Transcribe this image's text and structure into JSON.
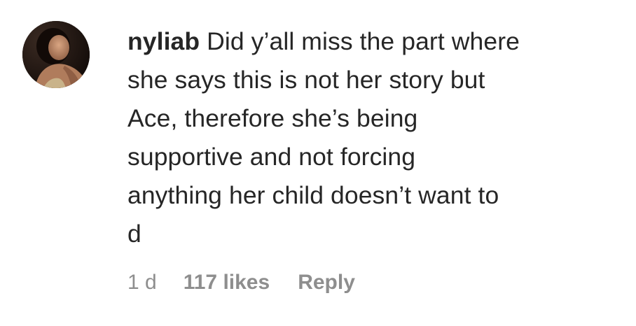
{
  "comment": {
    "username": "nyliab",
    "text_lines": [
      "Did y’all miss the part where",
      "she says this is not her story but",
      "Ace, therefore she’s being",
      "supportive and not forcing",
      "anything her child doesn’t want to",
      "d"
    ],
    "time": "1 d",
    "likes": "117 likes",
    "reply_label": "Reply"
  },
  "icons": {
    "avatar": "user-profile-photo"
  }
}
